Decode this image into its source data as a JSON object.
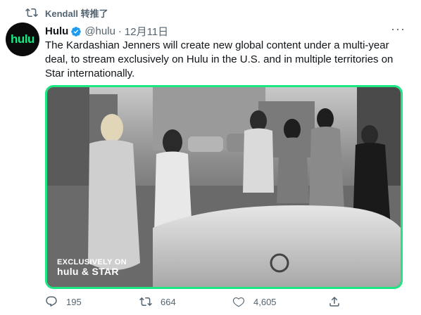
{
  "retweet": {
    "label": "Kendall 转推了",
    "icon": "retweet-icon"
  },
  "author": {
    "name": "Hulu",
    "handle": "@hulu",
    "separator": "·",
    "date": "12月11日",
    "avatar_logo": "hulu",
    "verified_icon": "verified-badge-icon"
  },
  "tweet": {
    "text": "The Kardashian Jenners will create new global content under a multi-year deal, to stream exclusively on Hulu in the U.S. and in multiple territories on Star internationally."
  },
  "media": {
    "overlay_line1": "EXCLUSIVELY ON",
    "overlay_line2": "hulu & STAR",
    "border_color": "#1ce783"
  },
  "actions": {
    "reply_count": "195",
    "retweet_count": "664",
    "like_count": "4,605"
  },
  "colors": {
    "accent": "#1ce783",
    "secondary_text": "#536471",
    "verified": "#1d9bf0"
  }
}
